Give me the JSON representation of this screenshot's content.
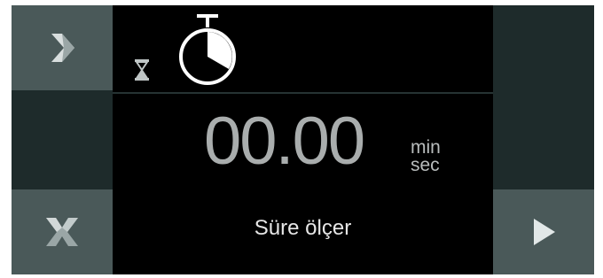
{
  "timer": {
    "display": "00.00",
    "unit_top": "min",
    "unit_bottom": "sec"
  },
  "mode": {
    "label": "Süre ölçer"
  },
  "icons": {
    "next": "chevron-right-icon",
    "close": "close-x-icon",
    "play": "play-icon",
    "hourglass": "hourglass-icon",
    "stopwatch": "stopwatch-icon"
  },
  "colors": {
    "button_bg": "#4a5959",
    "panel_bg": "#1e2b2b",
    "screen_bg": "#000000",
    "digits": "#a9adad"
  }
}
